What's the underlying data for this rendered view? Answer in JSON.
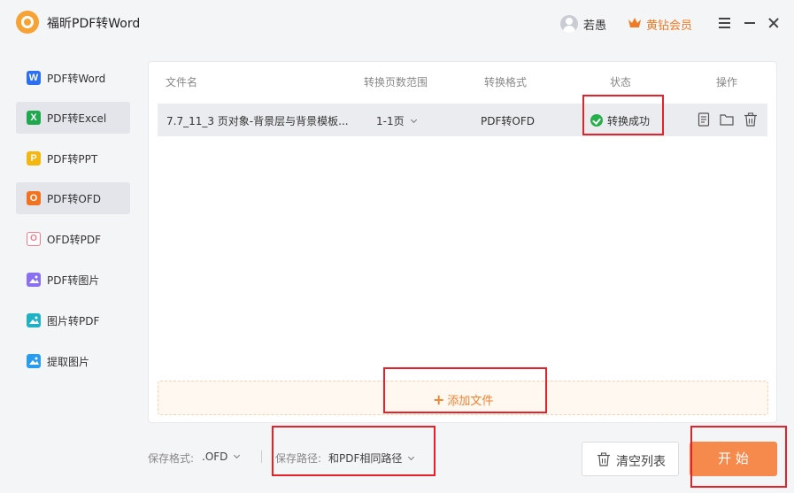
{
  "app": {
    "title": "福昕PDF转Word"
  },
  "user": {
    "name": "若愚",
    "vip_label": "黄钻会员"
  },
  "sidebar": {
    "items": [
      {
        "label": "PDF转Word",
        "icon": "W",
        "color": "#2b6ff2",
        "active": false
      },
      {
        "label": "PDF转Excel",
        "icon": "X",
        "color": "#1fa84e",
        "active": true
      },
      {
        "label": "PDF转PPT",
        "icon": "P",
        "color": "#f5b60f",
        "active": false
      },
      {
        "label": "PDF转OFD",
        "icon": "O",
        "color": "#f2731f",
        "active": true
      },
      {
        "label": "OFD转PDF",
        "icon": "O",
        "color": "#f07a89",
        "active": false
      },
      {
        "label": "PDF转图片",
        "icon": "img",
        "color": "#8a6ff0",
        "active": false
      },
      {
        "label": "图片转PDF",
        "icon": "img",
        "color": "#1fb1c4",
        "active": false
      },
      {
        "label": "提取图片",
        "icon": "img",
        "color": "#2a9cf0",
        "active": false
      }
    ]
  },
  "table": {
    "headers": {
      "name": "文件名",
      "pages": "转换页数范围",
      "format": "转换格式",
      "status": "状态",
      "actions": "操作"
    },
    "rows": [
      {
        "name": "7.7_11_3 页对象-背景层与背景模板...",
        "pages": "1-1页",
        "format": "PDF转OFD",
        "status": "转换成功"
      }
    ]
  },
  "add_files": {
    "label": "添加文件"
  },
  "footer": {
    "format_prefix": "保存格式:",
    "format_value": ".OFD",
    "path_prefix": "保存路径:",
    "path_value": "和PDF相同路径"
  },
  "buttons": {
    "clear": "清空列表",
    "start": "开 始"
  },
  "colors": {
    "accent": "#f58a4c",
    "success": "#25b14a",
    "highlight": "#e8202a"
  }
}
